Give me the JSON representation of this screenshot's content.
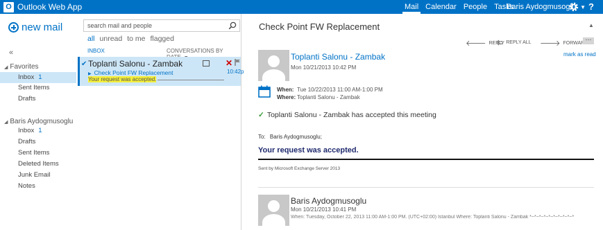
{
  "app": {
    "title": "Outlook Web App",
    "logo_glyph": "O",
    "accent": "#0072c6"
  },
  "topnav": {
    "items": [
      "Mail",
      "Calendar",
      "People",
      "Tasks"
    ],
    "active": "Mail",
    "user": "Baris Aydogmusoglu",
    "help": "?"
  },
  "leftnav": {
    "new_mail": "new mail",
    "collapse": "«",
    "favorites": {
      "header": "Favorites",
      "folders": [
        {
          "label": "Inbox",
          "count": "1"
        },
        {
          "label": "Sent Items",
          "count": ""
        },
        {
          "label": "Drafts",
          "count": ""
        }
      ]
    },
    "account": {
      "header": "Baris Aydogmusoglu",
      "folders": [
        {
          "label": "Inbox",
          "count": "1"
        },
        {
          "label": "Drafts",
          "count": ""
        },
        {
          "label": "Sent Items",
          "count": ""
        },
        {
          "label": "Deleted Items",
          "count": ""
        },
        {
          "label": "Junk Email",
          "count": ""
        },
        {
          "label": "Notes",
          "count": ""
        }
      ]
    }
  },
  "list": {
    "search_placeholder": "search mail and people",
    "filters": [
      "all",
      "unread",
      "to me",
      "flagged"
    ],
    "active_filter": "all",
    "folder_label": "INBOX",
    "sort_label": "CONVERSATIONS BY DATE",
    "items": [
      {
        "sender": "Toplanti Salonu - Zambak",
        "subject": "Check Point FW Replacement",
        "preview": "Your request was accepted.",
        "time": "10:42p"
      }
    ]
  },
  "reading": {
    "subject": "Check Point FW Replacement",
    "actions": {
      "reply": "REPLY",
      "reply_all": "REPLY ALL",
      "forward": "FORWARD",
      "more": "···"
    },
    "mark_as_read": "mark as read",
    "message1": {
      "sender": "Toplanti Salonu - Zambak",
      "date": "Mon 10/21/2013 10:42 PM",
      "when_label": "When:",
      "when": "Tue 10/22/2013 11:00 AM-1:00 PM",
      "where_label": "Where:",
      "where": "Toplanti Salonu - Zambak",
      "accepted": "Toplanti Salonu - Zambak has accepted this meeting",
      "to_label": "To:",
      "to": "Baris Aydogmusoglu;",
      "body_heading": "Your request was accepted.",
      "sent_by": "Sent by Microsoft Exchange Server 2013"
    },
    "message2": {
      "sender": "Baris Aydogmusoglu",
      "date": "Mon 10/21/2013 10:41 PM",
      "preview": "When: Tuesday, October 22, 2013 11:00 AM-1:00 PM. (UTC+02:00) Istanbul Where: Toplanti Salonu - Zambak  *~*~*~*~*~*~*~*~*~*"
    }
  }
}
